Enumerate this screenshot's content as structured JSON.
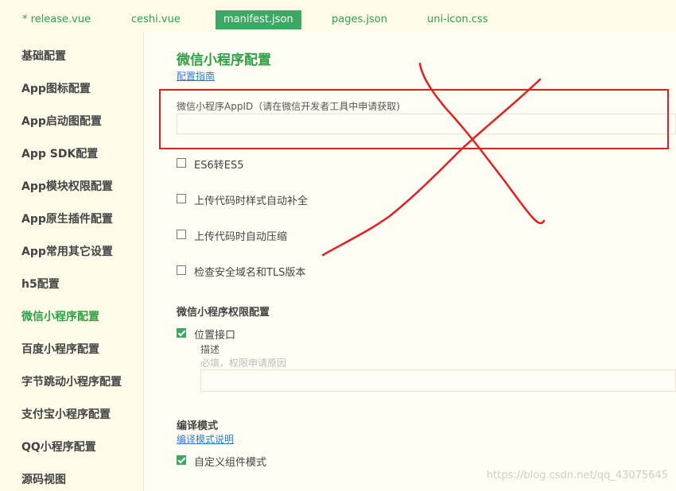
{
  "tabs": [
    {
      "label": "* release.vue",
      "active": false
    },
    {
      "label": "ceshi.vue",
      "active": false
    },
    {
      "label": "manifest.json",
      "active": true
    },
    {
      "label": "pages.json",
      "active": false
    },
    {
      "label": "uni-icon.css",
      "active": false
    }
  ],
  "sidebar": {
    "items": [
      {
        "label": "基础配置"
      },
      {
        "label": "App图标配置"
      },
      {
        "label": "App启动图配置"
      },
      {
        "label": "App SDK配置"
      },
      {
        "label": "App模块权限配置"
      },
      {
        "label": "App原生插件配置"
      },
      {
        "label": "App常用其它设置"
      },
      {
        "label": "h5配置"
      },
      {
        "label": "微信小程序配置",
        "active": true
      },
      {
        "label": "百度小程序配置"
      },
      {
        "label": "字节跳动小程序配置"
      },
      {
        "label": "支付宝小程序配置"
      },
      {
        "label": "QQ小程序配置"
      },
      {
        "label": "源码视图"
      }
    ]
  },
  "main": {
    "title": "微信小程序配置",
    "guide_link": "配置指南",
    "appid": {
      "label": "微信小程序AppID（请在微信开发者工具中申请获取)",
      "value": ""
    },
    "options": [
      {
        "label": "ES6转ES5",
        "checked": false
      },
      {
        "label": "上传代码时样式自动补全",
        "checked": false
      },
      {
        "label": "上传代码时自动压缩",
        "checked": false
      },
      {
        "label": "检查安全域名和TLS版本",
        "checked": false
      }
    ],
    "permissions": {
      "heading": "微信小程序权限配置",
      "location_label": "位置接口",
      "location_checked": true,
      "desc_label": "描述",
      "desc_placeholder": "必填，权限申请原因",
      "desc_value": ""
    },
    "compile": {
      "heading": "编译模式",
      "link": "编译模式说明",
      "custom_component_label": "自定义组件模式",
      "custom_component_checked": true
    }
  },
  "annotations": {
    "box_color": "#e02020",
    "cross_color": "#e02020"
  },
  "watermark": "https://blog.csdn.net/qq_43075645",
  "colors": {
    "accent": "#2ea046",
    "active_tab_bg": "#3da864",
    "link": "#2f7bd3",
    "background": "#fffdf4"
  }
}
